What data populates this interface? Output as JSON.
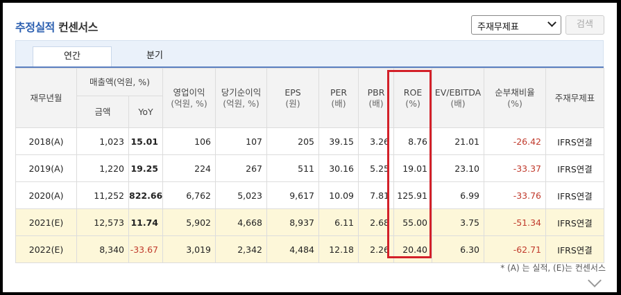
{
  "header": {
    "title_part1": "추정실적",
    "title_part2": "컨센서스",
    "select_value": "주재무제표",
    "search_label": "검색"
  },
  "tabs": [
    {
      "label": "연간",
      "active": true
    },
    {
      "label": "분기",
      "active": false
    }
  ],
  "table": {
    "col_period": "재무년월",
    "col_sales_group": "매출액(억원, %)",
    "col_sales_amount": "금액",
    "col_sales_yoy": "YoY",
    "col_op_line1": "영업이익",
    "col_op_line2": "(억원, %)",
    "col_net_line1": "당기순이익",
    "col_net_line2": "(억원, %)",
    "col_eps_line1": "EPS",
    "col_eps_line2": "(원)",
    "col_per_line1": "PER",
    "col_per_line2": "(배)",
    "col_pbr_line1": "PBR",
    "col_pbr_line2": "(배)",
    "col_roe_line1": "ROE",
    "col_roe_line2": "(%)",
    "col_ev_line1": "EV/EBITDA",
    "col_ev_line2": "(배)",
    "col_debt_line1": "순부채비율",
    "col_debt_line2": "(%)",
    "col_std": "주재무제표",
    "rows": [
      {
        "period": "2018(A)",
        "sales": "1,023",
        "yoy": "15.01",
        "op": "106",
        "net": "107",
        "eps": "205",
        "per": "39.15",
        "pbr": "3.26",
        "roe": "8.76",
        "ev": "21.01",
        "debt": "-26.42",
        "std": "IFRS연결"
      },
      {
        "period": "2019(A)",
        "sales": "1,220",
        "yoy": "19.25",
        "op": "224",
        "net": "267",
        "eps": "511",
        "per": "30.16",
        "pbr": "5.25",
        "roe": "19.01",
        "ev": "23.10",
        "debt": "-33.37",
        "std": "IFRS연결"
      },
      {
        "period": "2020(A)",
        "sales": "11,252",
        "yoy": "822.66",
        "op": "6,762",
        "net": "5,023",
        "eps": "9,617",
        "per": "10.09",
        "pbr": "7.81",
        "roe": "125.91",
        "ev": "6.99",
        "debt": "-33.76",
        "std": "IFRS연결"
      },
      {
        "period": "2021(E)",
        "sales": "12,573",
        "yoy": "11.74",
        "op": "5,902",
        "net": "4,668",
        "eps": "8,937",
        "per": "6.11",
        "pbr": "2.68",
        "roe": "55.00",
        "ev": "3.75",
        "debt": "-51.34",
        "std": "IFRS연결"
      },
      {
        "period": "2022(E)",
        "sales": "8,340",
        "yoy": "-33.67",
        "op": "3,019",
        "net": "2,342",
        "eps": "4,484",
        "per": "12.18",
        "pbr": "2.26",
        "roe": "20.40",
        "ev": "6.30",
        "debt": "-62.71",
        "std": "IFRS연결"
      }
    ]
  },
  "footnote": "* (A) 는 실적, (E)는 컨센서스",
  "colors": {
    "title_blue": "#2b5fb0",
    "negative_red": "#c0392b",
    "estimate_row_bg": "#fdf7d9",
    "highlight_red": "#d32029"
  }
}
